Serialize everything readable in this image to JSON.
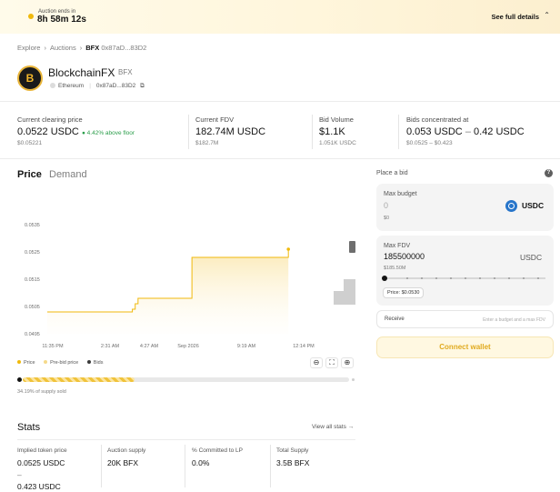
{
  "banner": {
    "label": "Auction ends in",
    "countdown": "8h 58m 12s",
    "details_label": "See full details"
  },
  "breadcrumb": {
    "items": [
      "Explore",
      "Auctions"
    ],
    "current_symbol": "BFX",
    "current_address": "0x87aD...83D2"
  },
  "token": {
    "name": "BlockchainFX",
    "symbol": "BFX",
    "chain": "Ethereum",
    "address": "0x87aD...83D2"
  },
  "metrics": [
    {
      "label": "Current clearing price",
      "value": "0.0522 USDC",
      "badge": "4.42% above floor",
      "sub": "$0.05221"
    },
    {
      "label": "Current FDV",
      "value": "182.74M USDC",
      "sub": "$182.7M"
    },
    {
      "label": "Bid Volume",
      "value": "$1.1K",
      "sub": "1.051K USDC"
    },
    {
      "label": "Bids concentrated at",
      "value_low": "0.053 USDC",
      "value_dash": "–",
      "value_high": "0.42 USDC",
      "sub": "$0.0525 – $0.423"
    }
  ],
  "tabs": {
    "price": "Price",
    "demand": "Demand"
  },
  "chart_data": {
    "type": "line",
    "y_ticks": [
      "0.0535",
      "0.0525",
      "0.0515",
      "0.0505",
      "0.0495"
    ],
    "x_ticks": [
      "11:35 PM",
      "2:31 AM",
      "4:27 AM",
      "Sep 2026",
      "9:19 AM",
      "12:14 PM"
    ],
    "ylim": [
      0.0495,
      0.0535
    ],
    "series": [
      {
        "name": "Price",
        "x": [
          0,
          0.29,
          0.3,
          0.31,
          0.32,
          0.5,
          0.51,
          0.84,
          0.85
        ],
        "y": [
          0.0503,
          0.0503,
          0.0504,
          0.0506,
          0.0508,
          0.0508,
          0.0523,
          0.0523,
          0.0526
        ]
      }
    ],
    "legend": [
      "Price",
      "Pre-bid price",
      "Bids"
    ],
    "colors": {
      "price": "#f0b90b",
      "prebid": "#f5d98a",
      "bids": "#9e9e9e"
    }
  },
  "progress": {
    "fraction": 0.3419,
    "label": "34.19% of supply sold"
  },
  "stats": {
    "title": "Stats",
    "view_all": "View all stats →",
    "items": [
      {
        "label": "Implied token price",
        "value": "0.0525 USDC",
        "value2": "–",
        "value3": "0.423 USDC"
      },
      {
        "label": "Auction supply",
        "value": "20K BFX"
      },
      {
        "label": "% Committed to LP",
        "value": "0.0%"
      },
      {
        "label": "Total Supply",
        "value": "3.5B BFX"
      }
    ]
  },
  "bid": {
    "title": "Place a bid",
    "max_budget_label": "Max budget",
    "max_budget_placeholder": "0",
    "max_budget_usd": "$0",
    "currency": "USDC",
    "max_fdv_label": "Max FDV",
    "max_fdv_value": "185500000",
    "max_fdv_usd": "$185.50M",
    "max_fdv_currency": "USDC",
    "price_chip": "Price: $0.0530",
    "receive_label": "Receive",
    "receive_hint": "Enter a budget and a max FDV",
    "connect_label": "Connect wallet"
  }
}
